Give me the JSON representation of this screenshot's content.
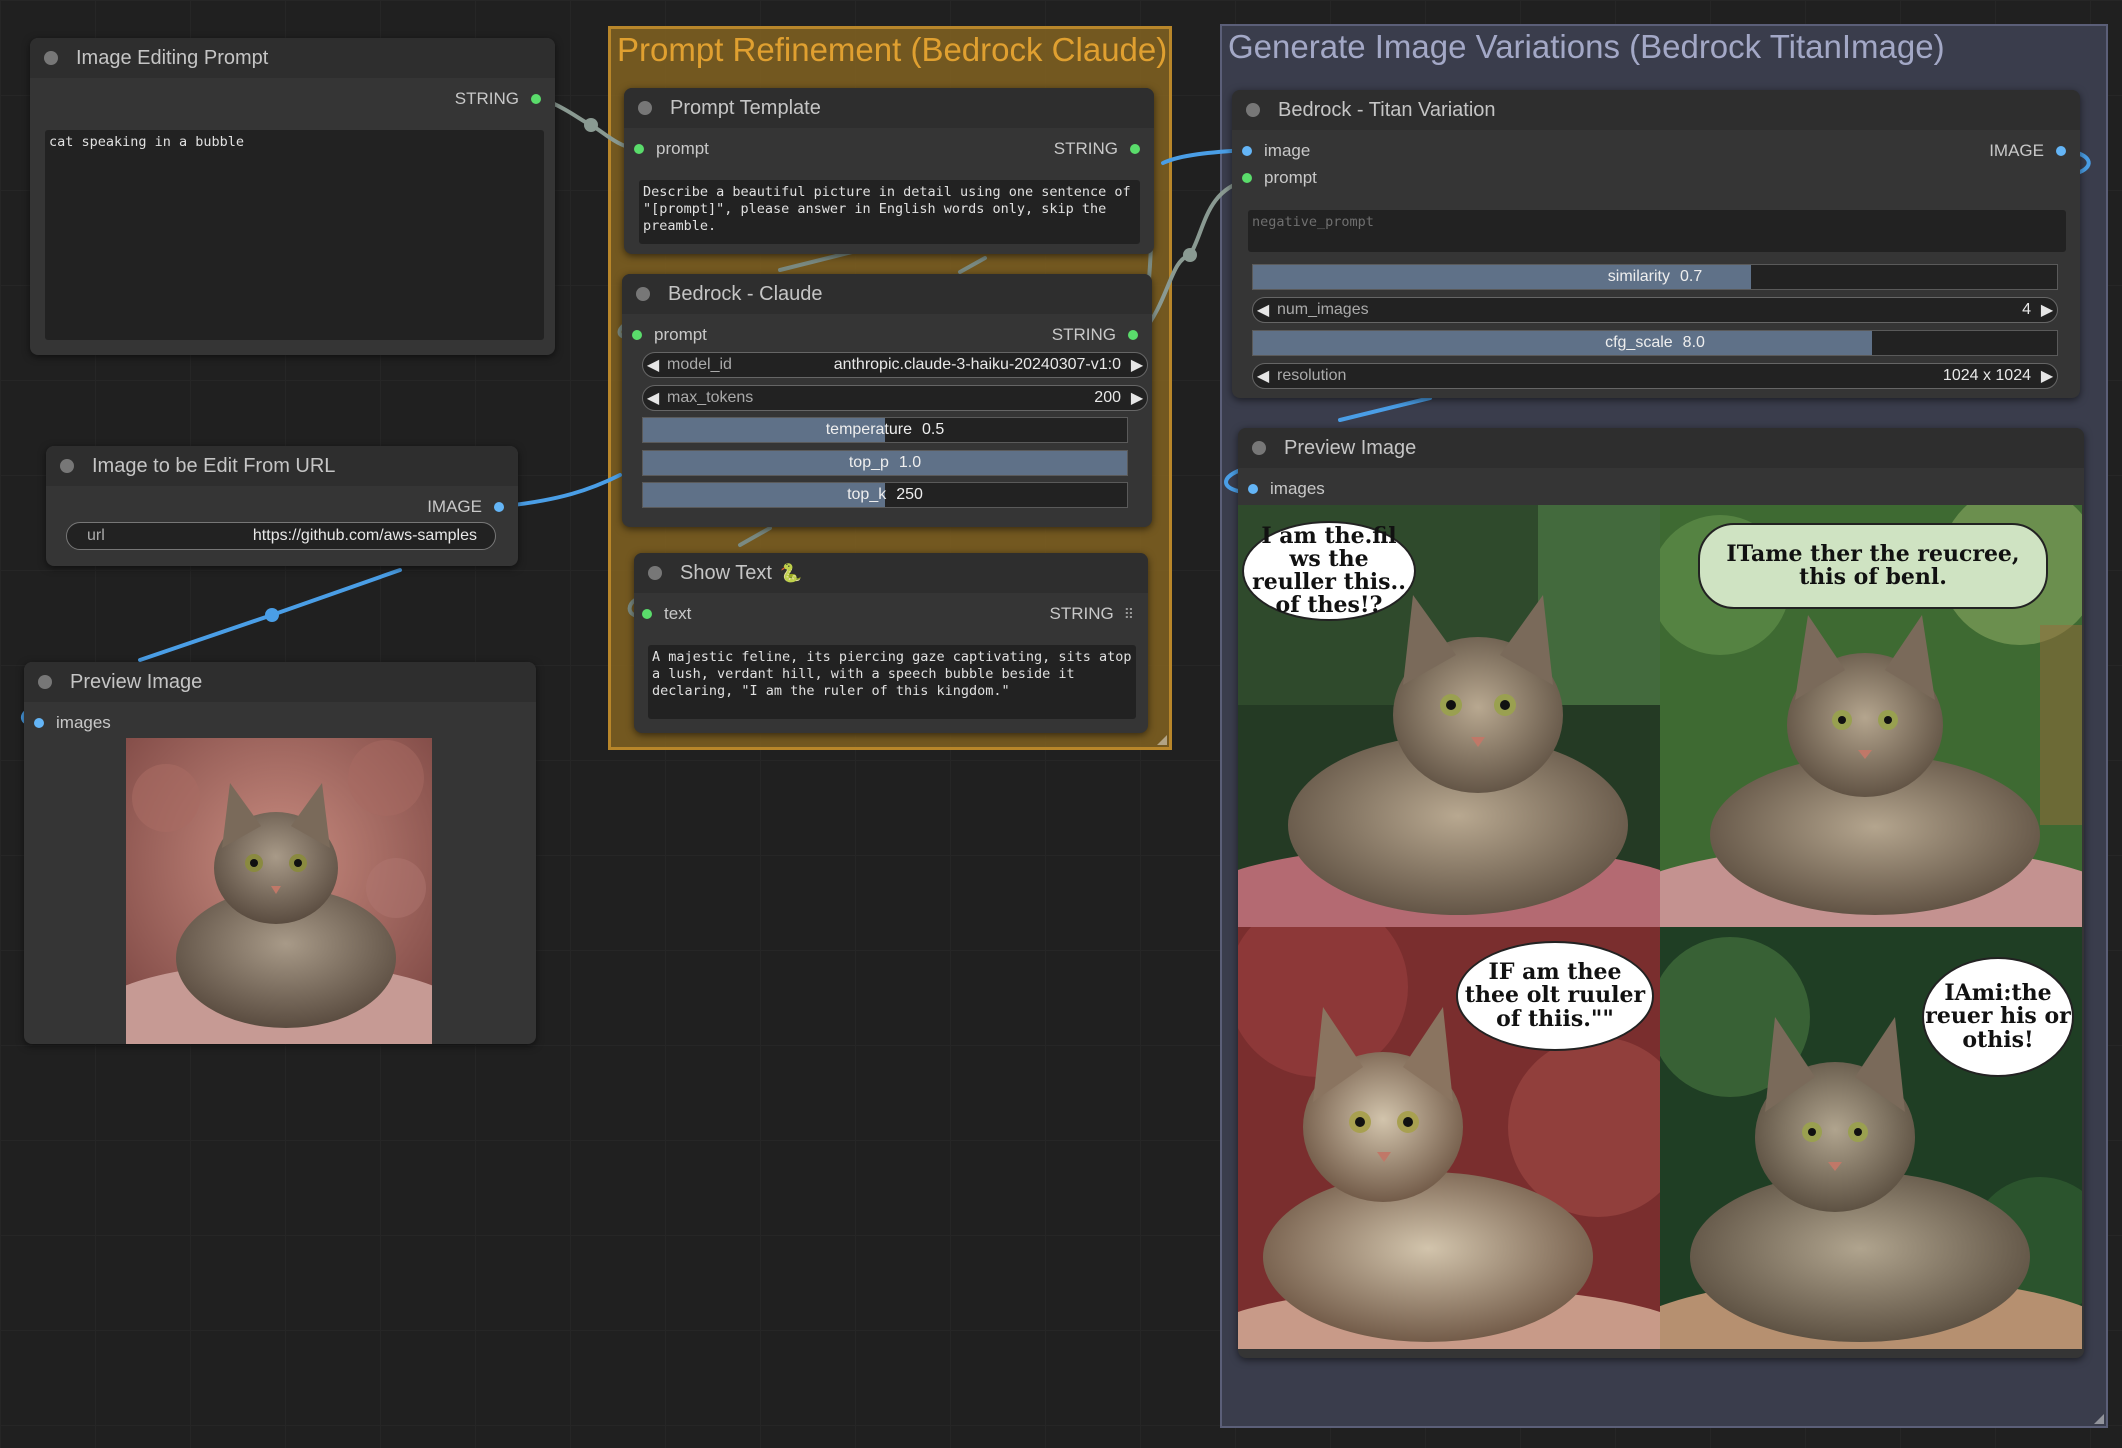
{
  "groups": {
    "claude": {
      "title": "Prompt Refinement (Bedrock Claude)"
    },
    "titan": {
      "title": "Generate Image Variations (Bedrock TitanImage)"
    }
  },
  "nodes": {
    "image_editing_prompt": {
      "title": "Image Editing Prompt",
      "out_label": "STRING",
      "text": "cat speaking in a bubble"
    },
    "image_from_url": {
      "title": "Image to be Edit From URL",
      "out_label": "IMAGE",
      "url_label": "url",
      "url_value": "https://github.com/aws-samples"
    },
    "preview_left": {
      "title": "Preview Image",
      "in_label": "images"
    },
    "prompt_template": {
      "title": "Prompt Template",
      "in_label": "prompt",
      "out_label": "STRING",
      "text": "Describe a beautiful picture in detail using one sentence of \"[prompt]\", please answer in English words only, skip the preamble."
    },
    "bedrock_claude": {
      "title": "Bedrock - Claude",
      "in_label": "prompt",
      "out_label": "STRING",
      "model_id_label": "model_id",
      "model_id_value": "anthropic.claude-3-haiku-20240307-v1:0",
      "max_tokens_label": "max_tokens",
      "max_tokens_value": "200",
      "temperature_label": "temperature",
      "temperature_value": "0.5",
      "temperature_fraction": 0.5,
      "top_p_label": "top_p",
      "top_p_value": "1.0",
      "top_p_fraction": 1.0,
      "top_k_label": "top_k",
      "top_k_value": "250",
      "top_k_fraction": 0.5
    },
    "show_text": {
      "title": "Show Text",
      "title_icon": "🐍",
      "in_label": "text",
      "out_label": "STRING",
      "text": "A majestic feline, its piercing gaze captivating, sits atop a lush, verdant hill, with a speech bubble beside it declaring, \"I am the ruler of this kingdom.\""
    },
    "titan_variation": {
      "title": "Bedrock - Titan Variation",
      "in_image_label": "image",
      "in_prompt_label": "prompt",
      "out_label": "IMAGE",
      "negative_prompt_placeholder": "negative_prompt",
      "similarity_label": "similarity",
      "similarity_value": "0.7",
      "similarity_fraction": 0.62,
      "num_images_label": "num_images",
      "num_images_value": "4",
      "cfg_scale_label": "cfg_scale",
      "cfg_scale_value": "8.0",
      "cfg_scale_fraction": 0.77,
      "resolution_label": "resolution",
      "resolution_value": "1024 x 1024"
    },
    "preview_right": {
      "title": "Preview Image",
      "in_label": "images",
      "bubbles": [
        "I am the.fil ws the reuller this.. of thes!?",
        "ITame ther the reucree, this of benl.",
        "IF am thee thee olt ruuler of thiis.\"\"",
        "IAmi:the reuer his or othis!"
      ]
    }
  },
  "colors": {
    "string_slot": "#5adc6b",
    "image_slot": "#64b5f6",
    "link": "#4a9ee6",
    "claude_group": "#8a6820",
    "titan_group": "#3a3d4c"
  }
}
